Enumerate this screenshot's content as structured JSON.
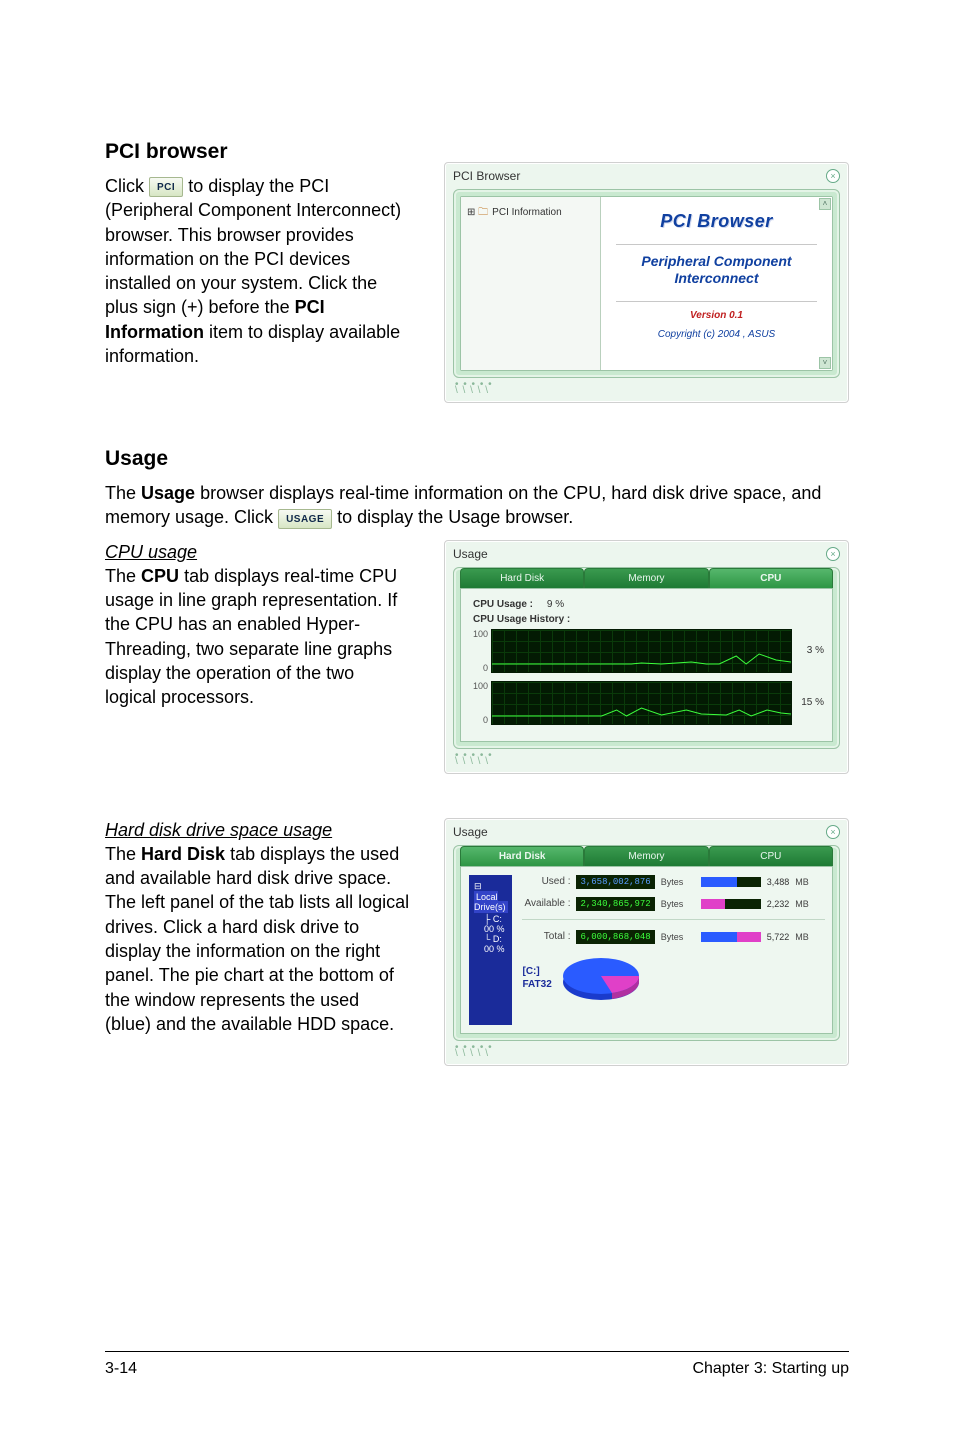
{
  "sections": {
    "pci": {
      "heading": "PCI browser",
      "body_before": "Click ",
      "btn": "PCI",
      "body_after": " to display the PCI (Peripheral Component Interconnect) browser. This browser provides information on the PCI devices installed on your system. Click the plus sign (+) before the ",
      "body_bold": "PCI Information",
      "body_end": " item to display available information."
    },
    "usage": {
      "heading": "Usage",
      "intro1_a": "The ",
      "intro1_b": "Usage",
      "intro1_c": " browser displays real-time information on the CPU, hard disk drive space, and memory usage. Click ",
      "intro1_btn": "USAGE",
      "intro1_d": " to display the Usage browser.",
      "cpu_sub": "CPU usage",
      "cpu_text_a": "The ",
      "cpu_text_b": "CPU",
      "cpu_text_c": " tab displays real-time CPU usage in line graph representation. If the CPU has an enabled Hyper-Threading, two separate line graphs display the operation of the two logical processors.",
      "hd_sub": "Hard disk drive space usage",
      "hd_text_a": "The ",
      "hd_text_b": "Hard Disk",
      "hd_text_c": " tab displays the used and available hard disk drive space. The left panel of the tab lists all logical drives. Click a hard disk drive to display the information on the right panel. The pie chart at the bottom of the window represents the used (blue) and the available HDD space."
    }
  },
  "shot_pci": {
    "title": "PCI Browser",
    "tree_item": "PCI Information",
    "h1": "PCI  Browser",
    "h2a": "Peripheral Component",
    "h2b": "Interconnect",
    "ver": "Version 0.1",
    "cpy": "Copyright (c) 2004 ,   ASUS"
  },
  "shot_cpu": {
    "title": "Usage",
    "tabs": {
      "hd": "Hard Disk",
      "mem": "Memory",
      "cpu": "CPU"
    },
    "usage_label": "CPU Usage :",
    "usage_val": "9   %",
    "history_label": "CPU Usage History :",
    "pct1": "3 %",
    "pct2": "15 %"
  },
  "shot_hd": {
    "title": "Usage",
    "tabs": {
      "hd": "Hard Disk",
      "mem": "Memory",
      "cpu": "CPU"
    },
    "tree": {
      "root": "Local Drive(s)",
      "c": "C:  00 %",
      "d": "D:  00 %"
    },
    "rows": {
      "used": {
        "label": "Used :",
        "val": "3,658,002,876",
        "unit": "Bytes",
        "mb": "3,488",
        "mbunit": "MB"
      },
      "avail": {
        "label": "Available :",
        "val": "2,340,865,972",
        "unit": "Bytes",
        "mb": "2,232",
        "mbunit": "MB"
      },
      "total": {
        "label": "Total :",
        "val": "6,000,868,048",
        "unit": "Bytes",
        "mb": "5,722",
        "mbunit": "MB"
      }
    },
    "pie_label_a": "[C:]",
    "pie_label_b": "FAT32"
  },
  "footer": {
    "left": "3-14",
    "right": "Chapter 3: Starting up"
  }
}
